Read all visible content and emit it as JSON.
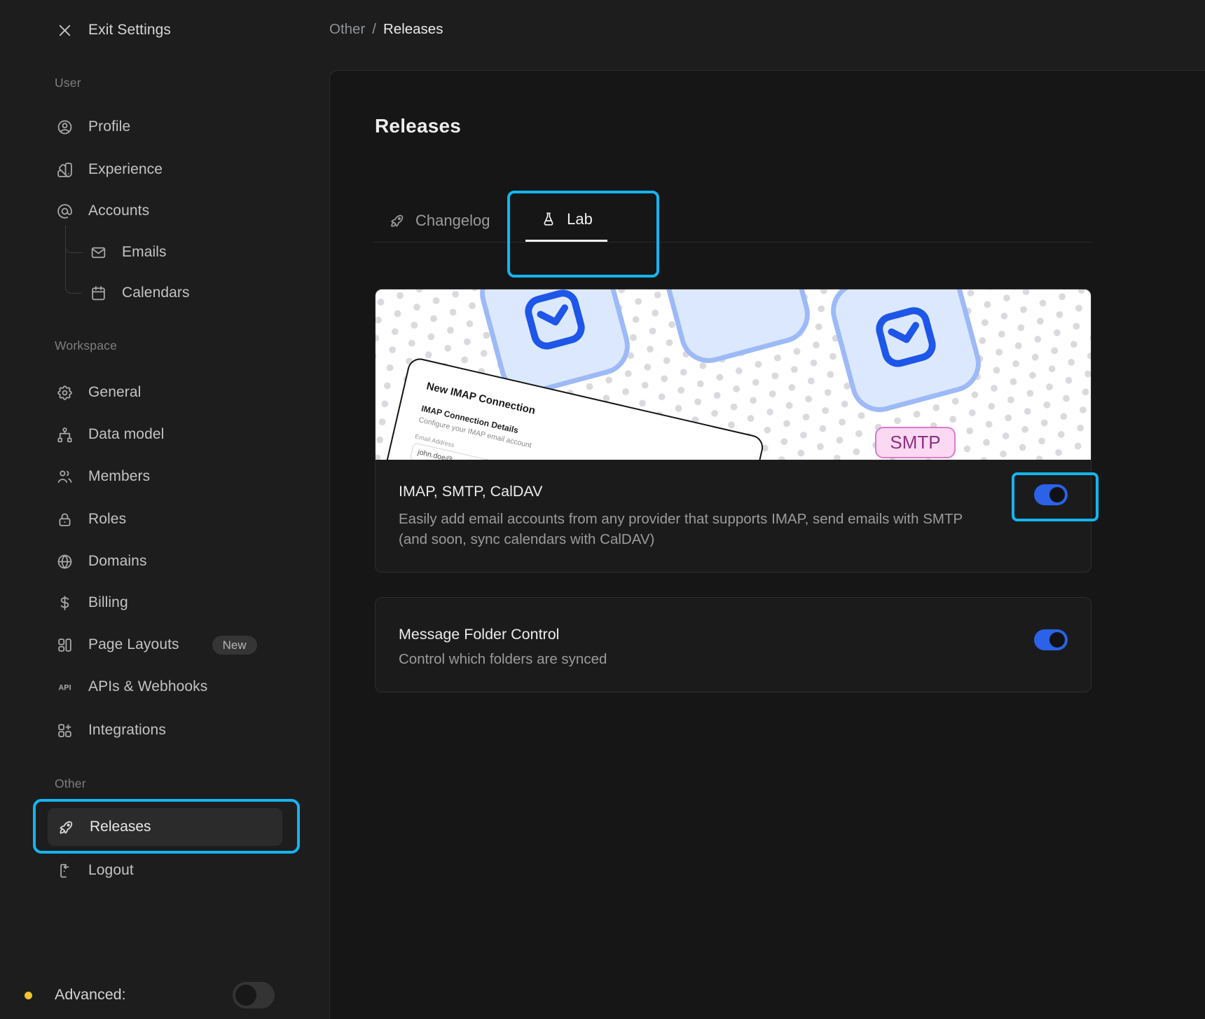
{
  "breadcrumb": {
    "parent": "Other",
    "separator": "/",
    "current": "Releases"
  },
  "sidebar": {
    "exit_label": "Exit Settings",
    "sections": [
      {
        "label": "User",
        "items": [
          {
            "icon": "user-circle",
            "label": "Profile"
          },
          {
            "icon": "color-swatch",
            "label": "Experience"
          },
          {
            "icon": "at-sign",
            "label": "Accounts",
            "children": [
              {
                "icon": "mail",
                "label": "Emails"
              },
              {
                "icon": "calendar",
                "label": "Calendars"
              }
            ]
          }
        ]
      },
      {
        "label": "Workspace",
        "items": [
          {
            "icon": "gear",
            "label": "General"
          },
          {
            "icon": "hierarchy",
            "label": "Data model"
          },
          {
            "icon": "users",
            "label": "Members"
          },
          {
            "icon": "lock",
            "label": "Roles"
          },
          {
            "icon": "globe",
            "label": "Domains"
          },
          {
            "icon": "currency-dollar",
            "label": "Billing"
          },
          {
            "icon": "layout",
            "label": "Page Layouts",
            "badge": "New"
          },
          {
            "icon": "api",
            "label": "APIs & Webhooks"
          },
          {
            "icon": "apps",
            "label": "Integrations"
          }
        ]
      },
      {
        "label": "Other",
        "items": [
          {
            "icon": "rocket",
            "label": "Releases",
            "selected": true
          },
          {
            "icon": "logout",
            "label": "Logout"
          }
        ]
      }
    ],
    "advanced": {
      "label": "Advanced:",
      "toggle_on": false
    }
  },
  "main": {
    "title": "Releases",
    "tabs": [
      {
        "icon": "rocket",
        "label": "Changelog",
        "active": false
      },
      {
        "icon": "flask",
        "label": "Lab",
        "active": true
      }
    ],
    "lab_features": [
      {
        "title": "IMAP, SMTP, CalDAV",
        "description": "Easily add email accounts from any provider that supports IMAP, send emails with SMTP (and soon, sync calendars with CalDAV)",
        "toggle_on": true
      },
      {
        "title": "Message Folder Control",
        "description": "Control which folders are synced",
        "toggle_on": true
      }
    ],
    "illustration": {
      "form_title": "New IMAP Connection",
      "form_section_title": "IMAP Connection Details",
      "form_section_subtitle": "Configure your IMAP email account",
      "form_field_label": "Email Address",
      "form_field_value": "john.doe@",
      "smtp_badge": "SMTP"
    }
  },
  "colors": {
    "annotation": "#14b4f0",
    "toggle_on": "#2b62e7",
    "advanced_dot": "#f2c12e"
  }
}
